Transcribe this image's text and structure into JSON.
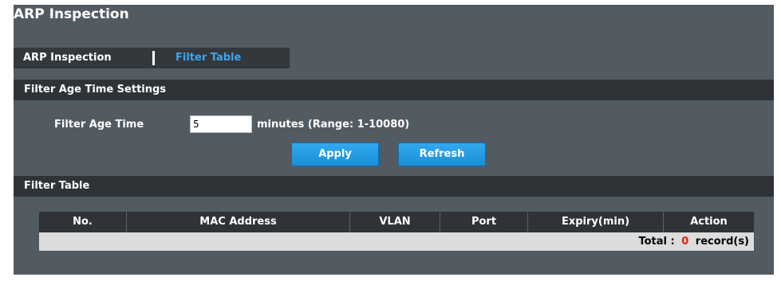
{
  "page": {
    "title": "ARP Inspection"
  },
  "tabs": [
    {
      "label": "ARP Inspection",
      "active": false
    },
    {
      "label": "Filter Table",
      "active": true
    }
  ],
  "settings": {
    "section_title": "Filter Age Time Settings",
    "age_label": "Filter Age Time",
    "age_value": "5",
    "units_text": "minutes (Range: 1-10080)",
    "apply_label": "Apply",
    "refresh_label": "Refresh"
  },
  "filter_table": {
    "section_title": "Filter Table",
    "columns": [
      "No.",
      "MAC Address",
      "VLAN",
      "Port",
      "Expiry(min)",
      "Action"
    ],
    "total_label": "Total :",
    "total_count": "0",
    "total_suffix": "record(s)"
  },
  "colors": {
    "panel_bg": "#525a62",
    "bar_bg": "#2f3337",
    "active_tab": "#3ba6f0",
    "button_blue": "#1b8ed7",
    "count_red": "#e21f1f"
  }
}
